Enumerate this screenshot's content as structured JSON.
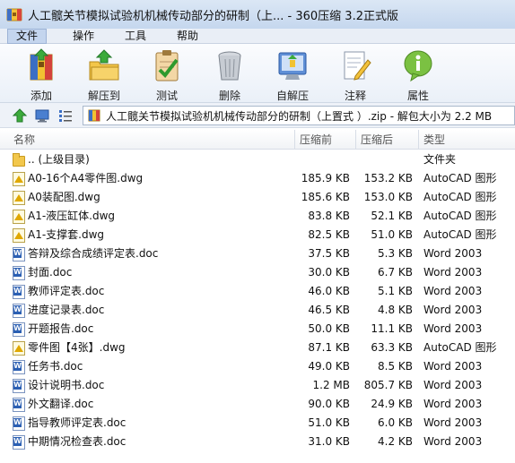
{
  "window": {
    "title": "人工髋关节模拟试验机机械传动部分的研制（上... - 360压缩 3.2正式版"
  },
  "menu": [
    "文件",
    "操作",
    "工具",
    "帮助"
  ],
  "toolbar": {
    "buttons": [
      {
        "label": "添加",
        "icon": "add-archive-icon"
      },
      {
        "label": "解压到",
        "icon": "extract-to-icon"
      },
      {
        "label": "测试",
        "icon": "test-clipboard-icon"
      },
      {
        "label": "删除",
        "icon": "delete-bin-icon"
      },
      {
        "label": "自解压",
        "icon": "self-extract-icon"
      },
      {
        "label": "注释",
        "icon": "comment-pencil-icon"
      },
      {
        "label": "属性",
        "icon": "info-bubble-icon"
      }
    ]
  },
  "address": {
    "path": "人工髋关节模拟试验机机械传动部分的研制（上置式 ）.zip - 解包大小为 2.2 MB"
  },
  "columns": {
    "name": "名称",
    "size": "压缩前",
    "packed": "压缩后",
    "type": "类型"
  },
  "files": [
    {
      "name": ".. (上级目录)",
      "size": "",
      "packed": "",
      "type": "文件夹",
      "kind": "folder"
    },
    {
      "name": "A0-16个A4零件图.dwg",
      "size": "185.9 KB",
      "packed": "153.2 KB",
      "type": "AutoCAD 图形",
      "kind": "dwg"
    },
    {
      "name": "A0装配图.dwg",
      "size": "185.6 KB",
      "packed": "153.0 KB",
      "type": "AutoCAD 图形",
      "kind": "dwg"
    },
    {
      "name": "A1-液压缸体.dwg",
      "size": "83.8 KB",
      "packed": "52.1 KB",
      "type": "AutoCAD 图形",
      "kind": "dwg"
    },
    {
      "name": "A1-支撑套.dwg",
      "size": "82.5 KB",
      "packed": "51.0 KB",
      "type": "AutoCAD 图形",
      "kind": "dwg"
    },
    {
      "name": "答辩及综合成绩评定表.doc",
      "size": "37.5 KB",
      "packed": "5.3 KB",
      "type": "Word 2003",
      "kind": "doc"
    },
    {
      "name": "封面.doc",
      "size": "30.0 KB",
      "packed": "6.7 KB",
      "type": "Word 2003",
      "kind": "doc"
    },
    {
      "name": "教师评定表.doc",
      "size": "46.0 KB",
      "packed": "5.1 KB",
      "type": "Word 2003",
      "kind": "doc"
    },
    {
      "name": "进度记录表.doc",
      "size": "46.5 KB",
      "packed": "4.8 KB",
      "type": "Word 2003",
      "kind": "doc"
    },
    {
      "name": "开题报告.doc",
      "size": "50.0 KB",
      "packed": "11.1 KB",
      "type": "Word 2003",
      "kind": "doc"
    },
    {
      "name": "零件图【4张】.dwg",
      "size": "87.1 KB",
      "packed": "63.3 KB",
      "type": "AutoCAD 图形",
      "kind": "dwg"
    },
    {
      "name": "任务书.doc",
      "size": "49.0 KB",
      "packed": "8.5 KB",
      "type": "Word 2003",
      "kind": "doc"
    },
    {
      "name": "设计说明书.doc",
      "size": "1.2 MB",
      "packed": "805.7 KB",
      "type": "Word 2003",
      "kind": "doc"
    },
    {
      "name": "外文翻译.doc",
      "size": "90.0 KB",
      "packed": "24.9 KB",
      "type": "Word 2003",
      "kind": "doc"
    },
    {
      "name": "指导教师评定表.doc",
      "size": "51.0 KB",
      "packed": "6.0 KB",
      "type": "Word 2003",
      "kind": "doc"
    },
    {
      "name": "中期情况检查表.doc",
      "size": "31.0 KB",
      "packed": "4.2 KB",
      "type": "Word 2003",
      "kind": "doc"
    }
  ],
  "colors": {
    "title_bar": "#c5d7ee",
    "menu_active": "#c4d5ee",
    "folder": "#f2c74c",
    "word_blue": "#2b5fb3"
  }
}
